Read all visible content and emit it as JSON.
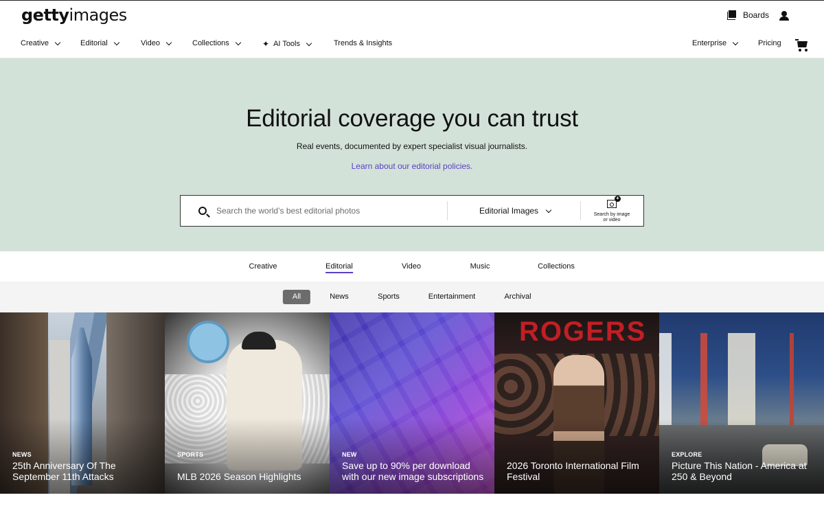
{
  "brand": {
    "logo_bold": "getty",
    "logo_light": "images"
  },
  "header": {
    "boards_label": "Boards",
    "nav": [
      {
        "label": "Creative",
        "has_dropdown": true
      },
      {
        "label": "Editorial",
        "has_dropdown": true
      },
      {
        "label": "Video",
        "has_dropdown": true
      },
      {
        "label": "Collections",
        "has_dropdown": true
      },
      {
        "label": "AI Tools",
        "has_dropdown": true,
        "icon": "sparkle-icon"
      },
      {
        "label": "Trends & Insights",
        "has_dropdown": false
      }
    ],
    "right_nav": [
      {
        "label": "Enterprise",
        "has_dropdown": true
      },
      {
        "label": "Pricing",
        "has_dropdown": false
      }
    ]
  },
  "hero": {
    "title": "Editorial coverage you can trust",
    "subtitle": "Real events, documented by expert specialist visual journalists.",
    "link": "Learn about our editorial policies.",
    "background": "#d3e2d8",
    "link_color": "#5b3fc4"
  },
  "search": {
    "placeholder": "Search the world’s best editorial photos",
    "value": "",
    "type_selected": "Editorial Images",
    "visual_search_label_1": "Search by image",
    "visual_search_label_2": "or video"
  },
  "tabs": [
    {
      "label": "Creative",
      "active": false
    },
    {
      "label": "Editorial",
      "active": true
    },
    {
      "label": "Video",
      "active": false
    },
    {
      "label": "Music",
      "active": false
    },
    {
      "label": "Collections",
      "active": false
    }
  ],
  "filters": [
    {
      "label": "All",
      "active": true
    },
    {
      "label": "News",
      "active": false
    },
    {
      "label": "Sports",
      "active": false
    },
    {
      "label": "Entertainment",
      "active": false
    },
    {
      "label": "Archival",
      "active": false
    }
  ],
  "cards": [
    {
      "tag": "NEWS",
      "title": "25th Anniversary Of The September 11th Attacks"
    },
    {
      "tag": "SPORTS",
      "title": "MLB 2026 Season Highlights"
    },
    {
      "tag": "NEW",
      "title": "Save up to 90% per download with our new image subscriptions"
    },
    {
      "tag": "",
      "title": "2026 Toronto International Film Festival"
    },
    {
      "tag": "EXPLORE",
      "title": "Picture This Nation - America at 250 & Beyond"
    }
  ],
  "card_image_text": {
    "rogers_sign": "ROGERS"
  }
}
